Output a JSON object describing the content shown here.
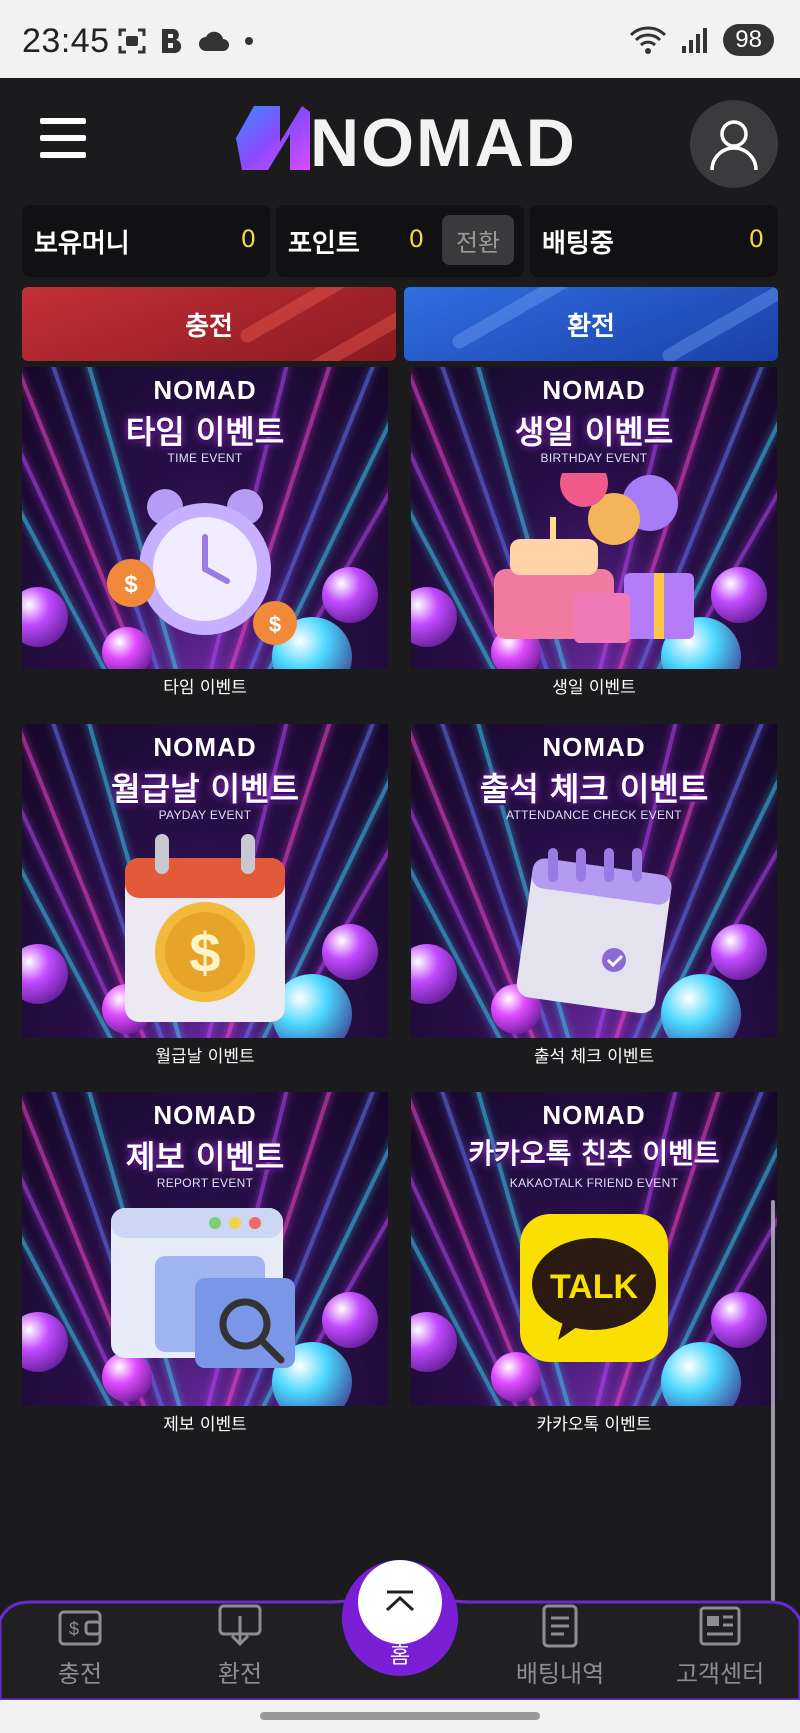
{
  "status_bar": {
    "time": "23:45",
    "battery": "98",
    "icons": [
      "screenshot-icon",
      "b-app-icon",
      "cloud-icon",
      "dot-icon",
      "wifi-icon",
      "signal-icon"
    ]
  },
  "header": {
    "logo_text": "NOMAD",
    "menu_icon": "hamburger-icon",
    "avatar_icon": "user-icon"
  },
  "balances": {
    "money_label": "보유머니",
    "money_value": "0",
    "point_label": "포인트",
    "point_value": "0",
    "convert_label": "전환",
    "betting_label": "배팅중",
    "betting_value": "0"
  },
  "actions": {
    "charge_label": "충전",
    "exchange_label": "환전"
  },
  "events": [
    {
      "logo": "NOMAD",
      "title": "타임 이벤트",
      "subtitle": "TIME EVENT",
      "caption": "타임 이벤트",
      "icon": "alarm-clock-icon"
    },
    {
      "logo": "NOMAD",
      "title": "생일 이벤트",
      "subtitle": "BIRTHDAY EVENT",
      "caption": "생일 이벤트",
      "icon": "birthday-cake-icon"
    },
    {
      "logo": "NOMAD",
      "title": "월급날 이벤트",
      "subtitle": "PAYDAY EVENT",
      "caption": "월급날 이벤트",
      "icon": "calendar-coin-icon"
    },
    {
      "logo": "NOMAD",
      "title": "출석 체크 이벤트",
      "subtitle": "ATTENDANCE CHECK EVENT",
      "caption": "출석 체크 이벤트",
      "icon": "attendance-calendar-icon"
    },
    {
      "logo": "NOMAD",
      "title": "제보 이벤트",
      "subtitle": "REPORT EVENT",
      "caption": "제보 이벤트",
      "icon": "report-window-icon"
    },
    {
      "logo": "NOMAD",
      "title": "카카오톡 친추 이벤트",
      "subtitle": "KAKAOTALK FRIEND EVENT",
      "caption": "카카오톡 이벤트",
      "icon": "kakaotalk-icon",
      "badge": "TALK"
    }
  ],
  "bottom_nav": {
    "charge": "충전",
    "exchange": "환전",
    "home": "홈",
    "bet_history": "배팅내역",
    "support": "고객센터"
  },
  "colors": {
    "background": "#1b1b1d",
    "balance_value": "#f1d84a",
    "charge": "#c53037",
    "exchange": "#2f6fe0",
    "home_accent": "#7b1fd6"
  }
}
